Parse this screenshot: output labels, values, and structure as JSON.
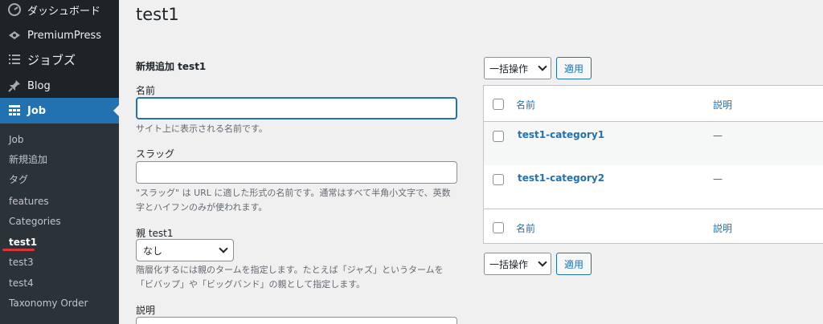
{
  "sidebar": {
    "items": [
      {
        "label": "ダッシュボード",
        "icon": "dashboard-icon"
      },
      {
        "label": "PremiumPress",
        "icon": "premiumpress-icon"
      },
      {
        "label": "ジョブズ",
        "icon": "list-icon"
      },
      {
        "label": "Blog",
        "icon": "pin-icon"
      },
      {
        "label": "Job",
        "icon": "grid-icon"
      }
    ],
    "submenu": [
      "Job",
      "新規追加",
      "タグ",
      "features",
      "Categories",
      "test1",
      "test3",
      "test4",
      "Taxonomy Order"
    ]
  },
  "page": {
    "title": "test1"
  },
  "form": {
    "heading": "新規追加 test1",
    "name_label": "名前",
    "name_value": "",
    "name_desc": "サイト上に表示される名前です。",
    "slug_label": "スラッグ",
    "slug_value": "",
    "slug_desc": "\"スラッグ\" は URL に適した形式の名前です。通常はすべて半角小文字で、英数字とハイフンのみが使われます。",
    "parent_label": "親 test1",
    "parent_value": "なし",
    "parent_desc": "階層化するには親のタームを指定します。たとえば「ジャズ」というタームを「ビバップ」や「ビッグバンド」の親として指定します。",
    "desc_label": "説明"
  },
  "list": {
    "bulk_label": "一括操作",
    "apply_label": "適用",
    "col_name": "名前",
    "col_desc": "説明",
    "rows": [
      {
        "name": "test1-category1",
        "desc": "—"
      },
      {
        "name": "test1-category2",
        "desc": "—"
      }
    ]
  }
}
